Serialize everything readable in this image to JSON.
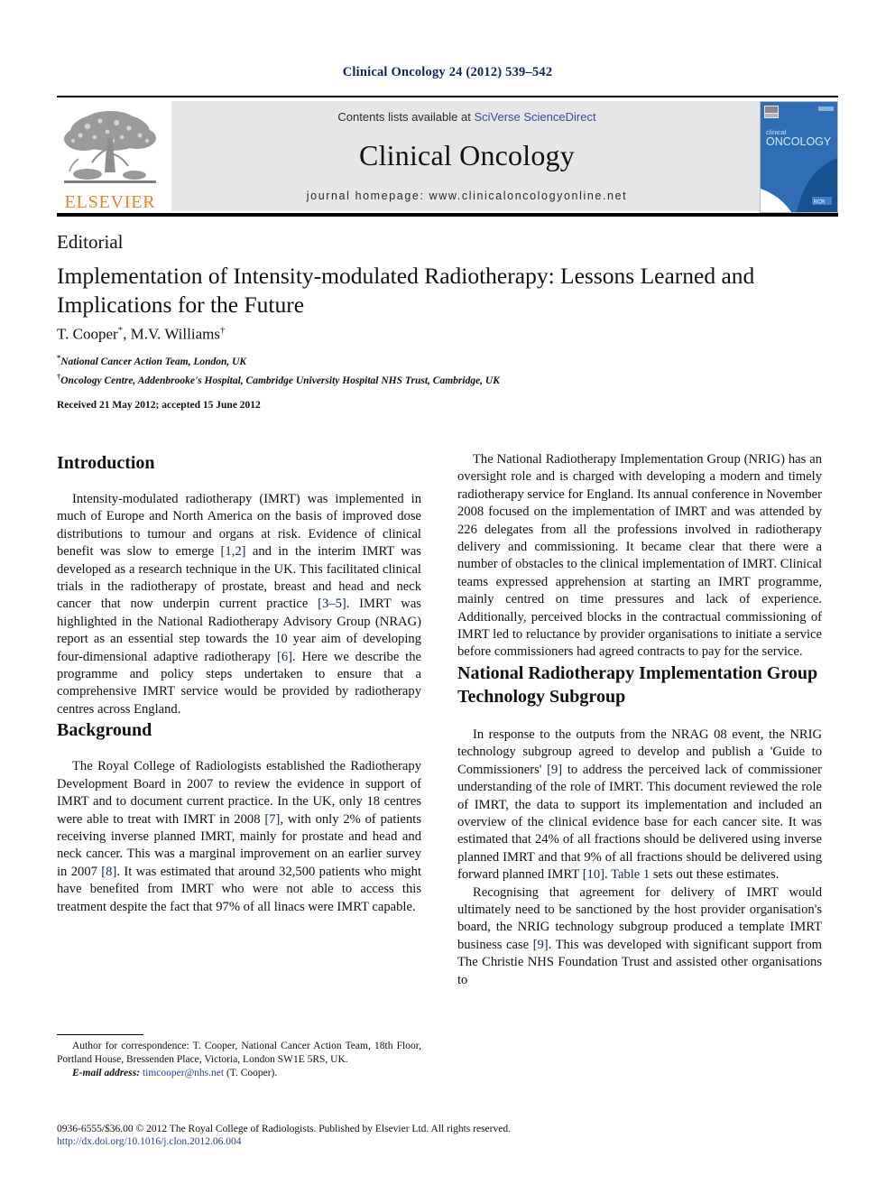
{
  "running_head": "Clinical Oncology 24 (2012) 539–542",
  "masthead": {
    "contents_prefix": "Contents lists available at ",
    "contents_link": "SciVerse ScienceDirect",
    "journal_name": "Clinical Oncology",
    "homepage": "journal homepage: www.clinicaloncologyonline.net",
    "publisher_wordmark": "ELSEVIER",
    "publisher_logo_icon": "elsevier-tree-icon",
    "cover_title_line1": "clinical",
    "cover_title_line2": "ONCOLOGY",
    "cover_badge": "RCR"
  },
  "article": {
    "type": "Editorial",
    "title": "Implementation of Intensity-modulated Radiotherapy: Lessons Learned and Implications for the Future",
    "authors": "T. Cooper *, M.V. Williams †",
    "author_1": "T. Cooper",
    "author_1_mark": "*",
    "author_2": "M.V. Williams",
    "author_2_mark": "†",
    "affiliation_1_mark": "*",
    "affiliation_1": "National Cancer Action Team, London, UK",
    "affiliation_2_mark": "†",
    "affiliation_2": "Oncology Centre, Addenbrooke's Hospital, Cambridge University Hospital NHS Trust, Cambridge, UK",
    "history": "Received 21 May 2012; accepted 15 June 2012"
  },
  "left_column": {
    "section_1_heading": "Introduction",
    "section_1_paragraph_a": "Intensity-modulated radiotherapy (IMRT) was implemented in much of Europe and North America on the basis of improved dose distributions to tumour and organs at risk. Evidence of clinical benefit was slow to emerge ",
    "section_1_ref_1": "[1,2]",
    "section_1_paragraph_b": " and in the interim IMRT was developed as a research technique in the UK. This facilitated clinical trials in the radiotherapy of prostate, breast and head and neck cancer that now underpin current practice ",
    "section_1_ref_2": "[3–5]",
    "section_1_paragraph_c": ". IMRT was highlighted in the National Radiotherapy Advisory Group (NRAG) report as an essential step towards the 10 year aim of developing four-dimensional adaptive radiotherapy ",
    "section_1_ref_3": "[6]",
    "section_1_paragraph_d": ". Here we describe the programme and policy steps undertaken to ensure that a comprehensive IMRT service would be provided by radiotherapy centres across England.",
    "section_2_heading": "Background",
    "section_2_paragraph_a": "The Royal College of Radiologists established the Radiotherapy Development Board in 2007 to review the evidence in support of IMRT and to document current practice. In the UK, only 18 centres were able to treat with IMRT in 2008 ",
    "section_2_ref_1": "[7]",
    "section_2_paragraph_b": ", with only 2% of patients receiving inverse planned IMRT, mainly for prostate and head and neck cancer. This was a marginal improvement on an earlier survey in 2007 ",
    "section_2_ref_2": "[8]",
    "section_2_paragraph_c": ". It was estimated that around 32,500 patients who might have benefited from IMRT who were not able to access this treatment despite the fact that 97% of all linacs were IMRT capable."
  },
  "right_column": {
    "paragraph_1": "The National Radiotherapy Implementation Group (NRIG) has an oversight role and is charged with developing a modern and timely radiotherapy service for England. Its annual conference in November 2008 focused on the implementation of IMRT and was attended by 226 delegates from all the professions involved in radiotherapy delivery and commissioning. It became clear that there were a number of obstacles to the clinical implementation of IMRT. Clinical teams expressed apprehension at starting an IMRT programme, mainly centred on time pressures and lack of experience. Additionally, perceived blocks in the contractual commissioning of IMRT led to reluctance by provider organisations to initiate a service before commissioners had agreed contracts to pay for the service.",
    "section_heading": "National Radiotherapy Implementation Group Technology Subgroup",
    "paragraph_2a": "In response to the outputs from the NRAG 08 event, the NRIG technology subgroup agreed to develop and publish a 'Guide to Commissioners' ",
    "paragraph_2_ref_1": "[9]",
    "paragraph_2b": " to address the perceived lack of commissioner understanding of the role of IMRT. This document reviewed the role of IMRT, the data to support its implementation and included an overview of the clinical evidence base for each cancer site. It was estimated that 24% of all fractions should be delivered using inverse planned IMRT and that 9% of all fractions should be delivered using forward planned IMRT ",
    "paragraph_2_ref_2": "[10]",
    "paragraph_2c": ". ",
    "paragraph_2_table_link": "Table 1",
    "paragraph_2d": " sets out these estimates.",
    "paragraph_3a": "Recognising that agreement for delivery of IMRT would ultimately need to be sanctioned by the host provider organisation's board, the NRIG technology subgroup produced a template IMRT business case ",
    "paragraph_3_ref_1": "[9]",
    "paragraph_3b": ". This was developed with significant support from The Christie NHS Foundation Trust and assisted other organisations to"
  },
  "footnote": {
    "correspondence": "Author for correspondence: T. Cooper, National Cancer Action Team, 18th Floor, Portland House, Bressenden Place, Victoria, London SW1E 5RS, UK.",
    "email_label": "E-mail address:",
    "email": "timcooper@nhs.net",
    "email_suffix": " (T. Cooper).",
    "copyright": "0936-6555/$36.00 © 2012 The Royal College of Radiologists. Published by Elsevier Ltd. All rights reserved.",
    "doi": "http://dx.doi.org/10.1016/j.clon.2012.06.004"
  },
  "colors": {
    "link_blue": "#2a3f95",
    "ref_blue": "#13245c",
    "elsevier_orange": "#ee7f2d",
    "panel_grey": "#e6e6e6",
    "cover_blue": "#1f5fa8"
  }
}
